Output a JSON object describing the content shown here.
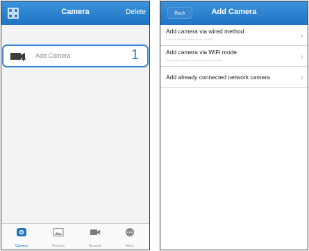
{
  "left_screen": {
    "header": {
      "menu_icon": "grid-icon",
      "title": "Camera",
      "delete_label": "Delete"
    },
    "add_camera_row": {
      "icon": "camera-plus-icon",
      "label": "Add Camera",
      "step_number": "1"
    },
    "tabs": [
      {
        "label": "Camera",
        "icon": "camera-tab-icon",
        "active": true
      },
      {
        "label": "Pictures",
        "icon": "picture-icon",
        "active": false
      },
      {
        "label": "Records",
        "icon": "video-icon",
        "active": false
      },
      {
        "label": "More",
        "icon": "more-icon",
        "active": false
      }
    ]
  },
  "right_screen": {
    "header": {
      "back_label": "Back",
      "title": "Add Camera"
    },
    "options": [
      {
        "title": "Add camera via wired method",
        "subtitle": "Connect ethernet cable to set up WiFi"
      },
      {
        "title": "Add camera via WiFi mode",
        "subtitle": "Set up WiFi without connecting ethernet cable"
      },
      {
        "title": "Add already connected network camera",
        "subtitle": ""
      }
    ]
  },
  "colors": {
    "nav_blue": "#1f74c3",
    "highlight_blue": "#3b87d3"
  }
}
